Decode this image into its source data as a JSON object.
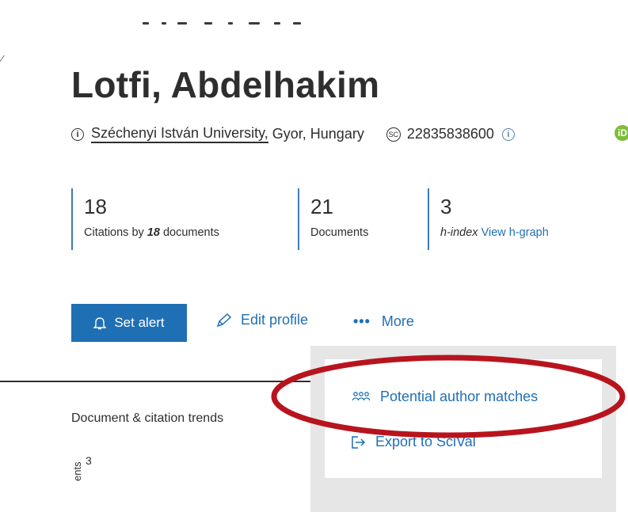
{
  "author": {
    "name": "Lotfi, Abdelhakim",
    "affiliation_link": "Széchenyi István University,",
    "affiliation_rest": " Gyor, Hungary",
    "author_id": "22835838600",
    "info_icon": "i",
    "scopus_icon": "SC",
    "badge_letter": "iD"
  },
  "metrics": {
    "citations": {
      "value": "18",
      "label_prefix": "Citations by ",
      "label_count": "18",
      "label_suffix": " documents"
    },
    "documents": {
      "value": "21",
      "label": "Documents"
    },
    "h_index": {
      "value": "3",
      "label": "h-index",
      "link": "View h-graph"
    }
  },
  "actions": {
    "set_alert": "Set alert",
    "edit_profile": "Edit profile",
    "more_dots": "•••",
    "more": "More"
  },
  "dropdown": {
    "items": [
      {
        "label": "Potential author matches",
        "icon": "people-group-icon"
      },
      {
        "label": "Export to SciVal",
        "icon": "export-icon"
      }
    ]
  },
  "trends": {
    "title": "Document & citation trends",
    "y_tick": "3",
    "y_axis_label": "ents"
  },
  "colors": {
    "primary": "#1f6fb5",
    "text": "#2e2e2e",
    "highlight": "#b8141e",
    "badge": "#7dbd3b"
  }
}
